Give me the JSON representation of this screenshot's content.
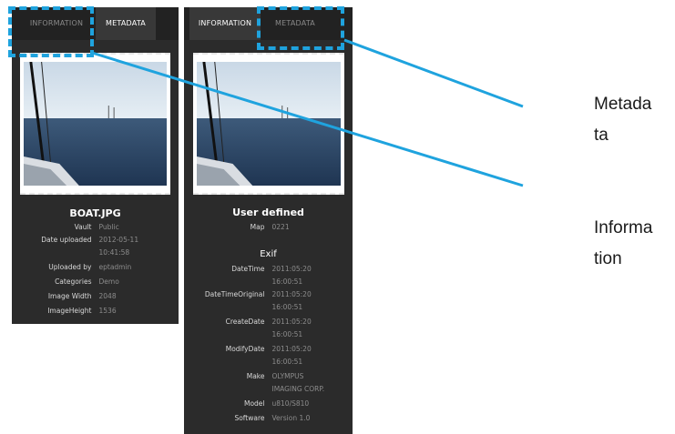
{
  "left_panel": {
    "tabs": [
      {
        "label": "INFORMATION",
        "active": false
      },
      {
        "label": "METADATA",
        "active": true
      }
    ],
    "title": "BOAT.JPG",
    "fields": [
      {
        "key": "Vault",
        "value": "Public"
      },
      {
        "key": "Date uploaded",
        "value": "2012-05-11",
        "value2": "10:41:58"
      },
      {
        "key": "Uploaded by",
        "value": "eptadmin"
      },
      {
        "key": "Categories",
        "value": "Demo"
      },
      {
        "key": "Image Width",
        "value": "2048"
      },
      {
        "key": "ImageHeight",
        "value": "1536"
      }
    ]
  },
  "right_panel": {
    "tabs": [
      {
        "label": "INFORMATION",
        "active": true
      },
      {
        "label": "METADATA",
        "active": false
      }
    ],
    "user_defined_title": "User defined",
    "user_defined_fields": [
      {
        "key": "Map",
        "value": "0221"
      }
    ],
    "exif_title": "Exif",
    "exif_fields": [
      {
        "key": "DateTime",
        "value": "2011:05:20",
        "value2": "16:00:51"
      },
      {
        "key": "DateTimeOriginal",
        "value": "2011:05:20",
        "value2": "16:00:51"
      },
      {
        "key": "CreateDate",
        "value": "2011:05:20",
        "value2": "16:00:51"
      },
      {
        "key": "ModifyDate",
        "value": "2011:05:20",
        "value2": "16:00:51"
      },
      {
        "key": "Make",
        "value": "OLYMPUS",
        "value2": "IMAGING CORP."
      },
      {
        "key": "Model",
        "value": "u810/S810"
      },
      {
        "key": "Software",
        "value": "Version 1.0"
      }
    ]
  },
  "callouts": {
    "metadata_label": {
      "line1": "Metada",
      "line2": "ta"
    },
    "information_label": {
      "line1": "Informa",
      "line2": "tion"
    }
  },
  "colors": {
    "panel_bg": "#2b2b2b",
    "tabbar_bg": "#222222",
    "active_tab_bg": "#383838",
    "highlight_blue": "#1fa3de"
  },
  "icons": {
    "photo": "sailboat-sea-photo"
  }
}
